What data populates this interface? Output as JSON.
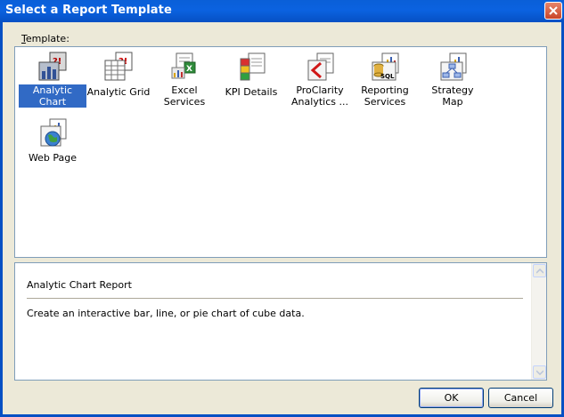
{
  "window": {
    "title": "Select a Report Template",
    "close_icon": "close-icon"
  },
  "group": {
    "label_first": "T",
    "label_rest": "emplate:"
  },
  "templates": [
    {
      "label": "Analytic Chart",
      "icon": "analytic-chart-icon",
      "selected": true
    },
    {
      "label": "Analytic Grid",
      "icon": "analytic-grid-icon",
      "selected": false
    },
    {
      "label": "Excel Services",
      "icon": "excel-services-icon",
      "selected": false
    },
    {
      "label": "KPI Details",
      "icon": "kpi-details-icon",
      "selected": false
    },
    {
      "label": "ProClarity Analytics ...",
      "icon": "proclarity-icon",
      "selected": false
    },
    {
      "label": "Reporting Services",
      "icon": "reporting-services-icon",
      "selected": false
    },
    {
      "label": "Strategy Map",
      "icon": "strategy-map-icon",
      "selected": false
    },
    {
      "label": "Web Page",
      "icon": "web-page-icon",
      "selected": false
    }
  ],
  "description": {
    "title": "Analytic Chart Report",
    "body": "Create an interactive bar, line, or pie chart of cube data."
  },
  "buttons": {
    "ok": "OK",
    "cancel": "Cancel"
  },
  "colors": {
    "titlebar": "#0a5fd8",
    "selection": "#316ac5",
    "dialog_bg": "#ece9d8"
  }
}
